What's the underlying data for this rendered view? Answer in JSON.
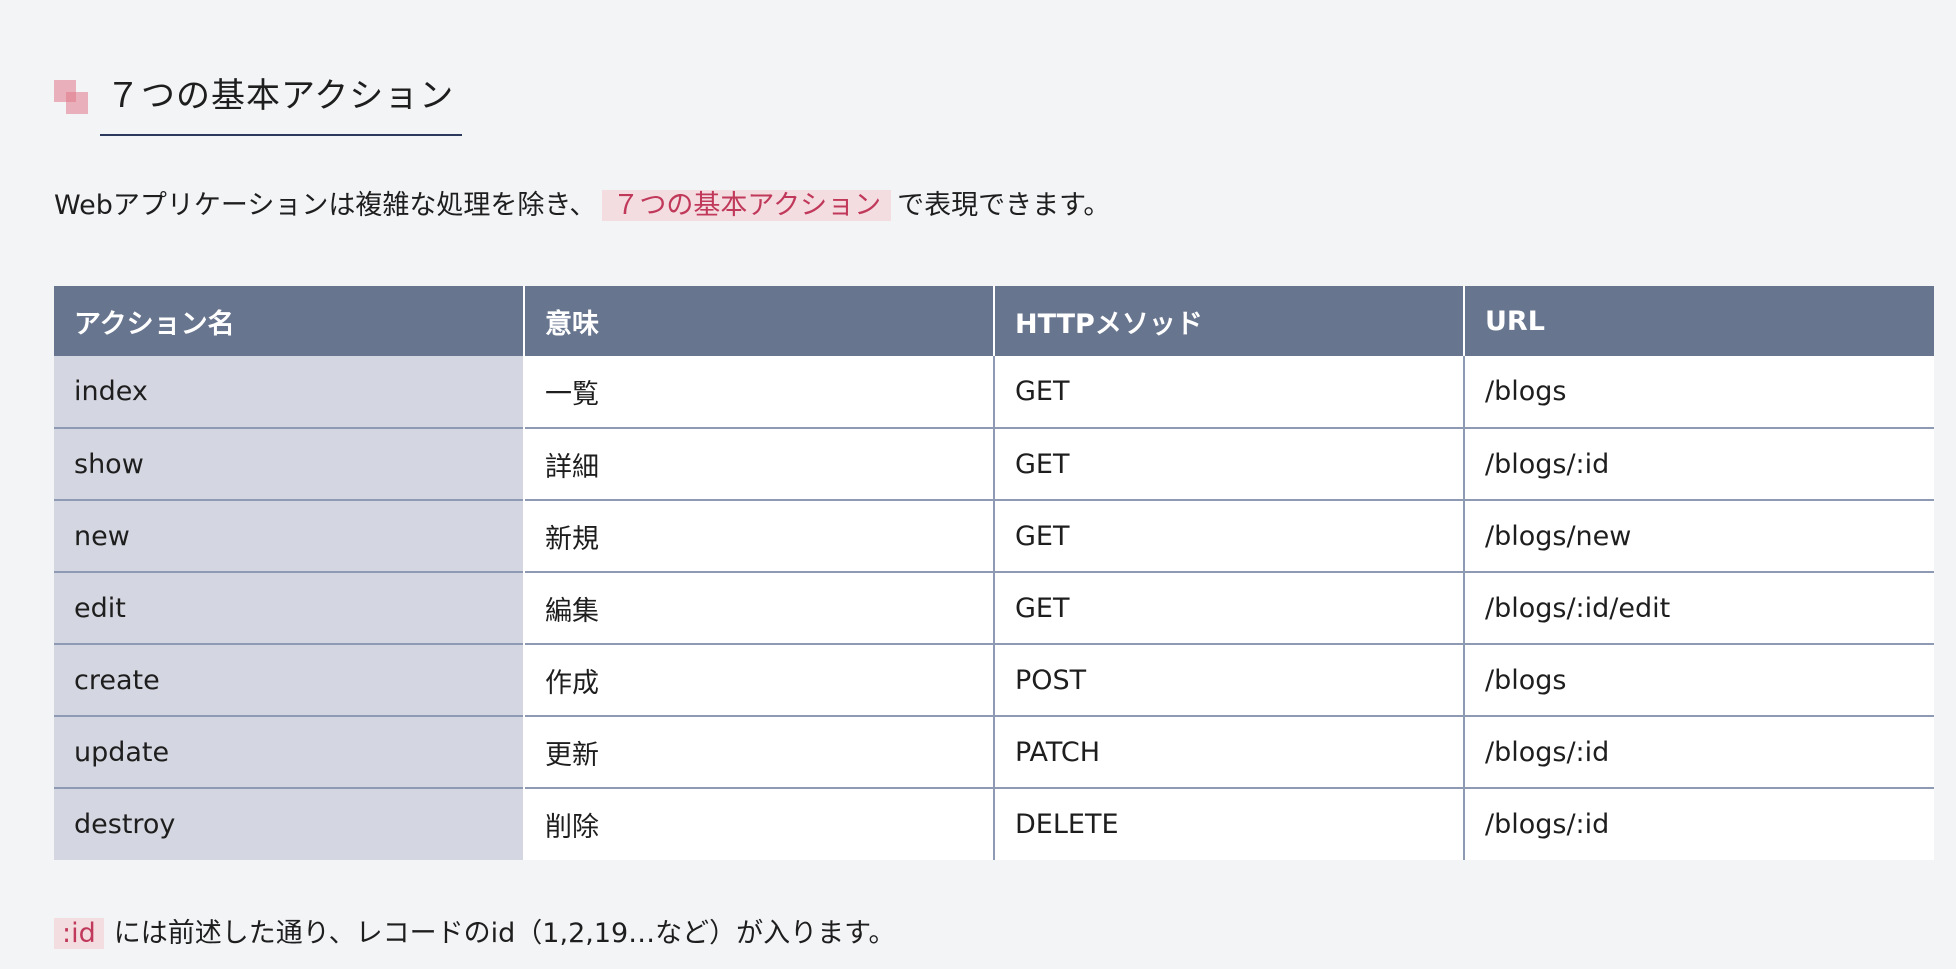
{
  "heading": {
    "title": "７つの基本アクション"
  },
  "intro": {
    "before": "Webアプリケーションは複雑な処理を除き、",
    "highlight": "７つの基本アクション",
    "after": "で表現できます。"
  },
  "table": {
    "headers": [
      "アクション名",
      "意味",
      "HTTPメソッド",
      "URL"
    ],
    "rows": [
      [
        "index",
        "一覧",
        "GET",
        "/blogs"
      ],
      [
        "show",
        "詳細",
        "GET",
        "/blogs/:id"
      ],
      [
        "new",
        "新規",
        "GET",
        "/blogs/new"
      ],
      [
        "edit",
        "編集",
        "GET",
        "/blogs/:id/edit"
      ],
      [
        "create",
        "作成",
        "POST",
        "/blogs"
      ],
      [
        "update",
        "更新",
        "PATCH",
        "/blogs/:id"
      ],
      [
        "destroy",
        "削除",
        "DELETE",
        "/blogs/:id"
      ]
    ]
  },
  "note": {
    "code": ":id",
    "text": "には前述した通り、レコードのid（1,2,19…など）が入ります。"
  },
  "colors": {
    "header_bg": "#68758f",
    "name_cell_bg": "#d4d7e1",
    "highlight_bg": "#f4dde1",
    "highlight_text": "#c0395a",
    "heading_underline": "#2b3a5c"
  }
}
